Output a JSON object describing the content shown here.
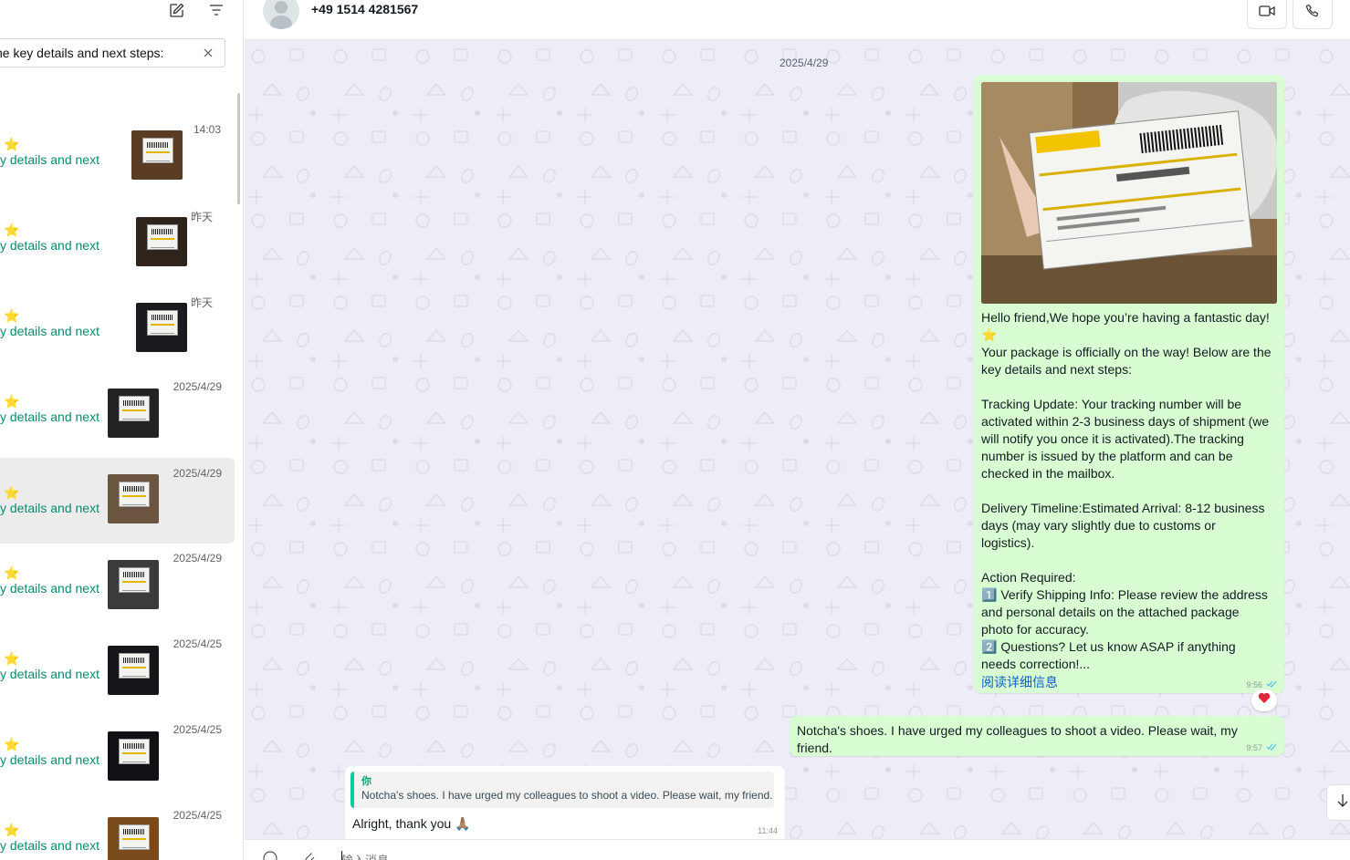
{
  "sidebar": {
    "search": {
      "value": "he key details and next steps:"
    },
    "chats": [
      {
        "time": "14:03",
        "star": "⭐",
        "preview": "y details and next"
      },
      {
        "time": "昨天",
        "star": "⭐",
        "preview": "y details and next"
      },
      {
        "time": "昨天",
        "star": "⭐",
        "preview": "y details and next"
      },
      {
        "time": "2025/4/29",
        "star": "⭐",
        "preview": "y details and next"
      },
      {
        "time": "2025/4/29",
        "star": "⭐",
        "preview": "y details and next"
      },
      {
        "time": "2025/4/29",
        "star": "⭐",
        "preview": "y details and next"
      },
      {
        "time": "2025/4/25",
        "star": "⭐",
        "preview": "y details and next"
      },
      {
        "time": "2025/4/25",
        "star": "⭐",
        "preview": "y details and next"
      },
      {
        "time": "2025/4/25",
        "star": "⭐",
        "preview": "y details and next"
      }
    ],
    "icons": [
      "compose-icon",
      "filter-icon",
      "close-icon"
    ]
  },
  "header": {
    "contact_name": "+49 1514 4281567",
    "icons": [
      "video-call-icon",
      "phone-icon"
    ]
  },
  "chat": {
    "date": "2025/4/29",
    "messages": [
      {
        "text": "Hello friend,We hope you’re having a fantastic day! ⭐\nYour package is officially on the way! Below are the key details and next steps:\n\nTracking Update: Your tracking number will be activated within 2-3 business days of shipment (we will notify you once it is activated).The tracking number is issued by the platform and can be checked in the mailbox.\n\nDelivery Timeline:Estimated Arrival: 8-12 business days (may vary slightly due to customs or logistics).\n\nAction Required:\n1️⃣ Verify Shipping Info: Please review the address and personal details on the attached package photo for accuracy.\n2️⃣ Questions? Let us know ASAP if anything needs correction!...",
        "read_more": "阅读详细信息",
        "time": "9:56",
        "reaction": "❤️"
      },
      {
        "text": "Notcha's shoes. I have urged my colleagues to shoot a video. Please wait, my friend.",
        "time": "9:57"
      },
      {
        "quote_author": "你",
        "quote_text": "Notcha's shoes. I have urged my colleagues to shoot a video. Please wait, my friend.",
        "text": "Alright, thank you 🙏🏽",
        "time": "11:44"
      }
    ]
  },
  "input": {
    "placeholder": "输入消息"
  },
  "colors": {
    "outgoing_bubble": "#d9fdd3",
    "accent": "#06cf9c",
    "chat_bg": "#eeecf6",
    "link": "#0b5fc8"
  }
}
